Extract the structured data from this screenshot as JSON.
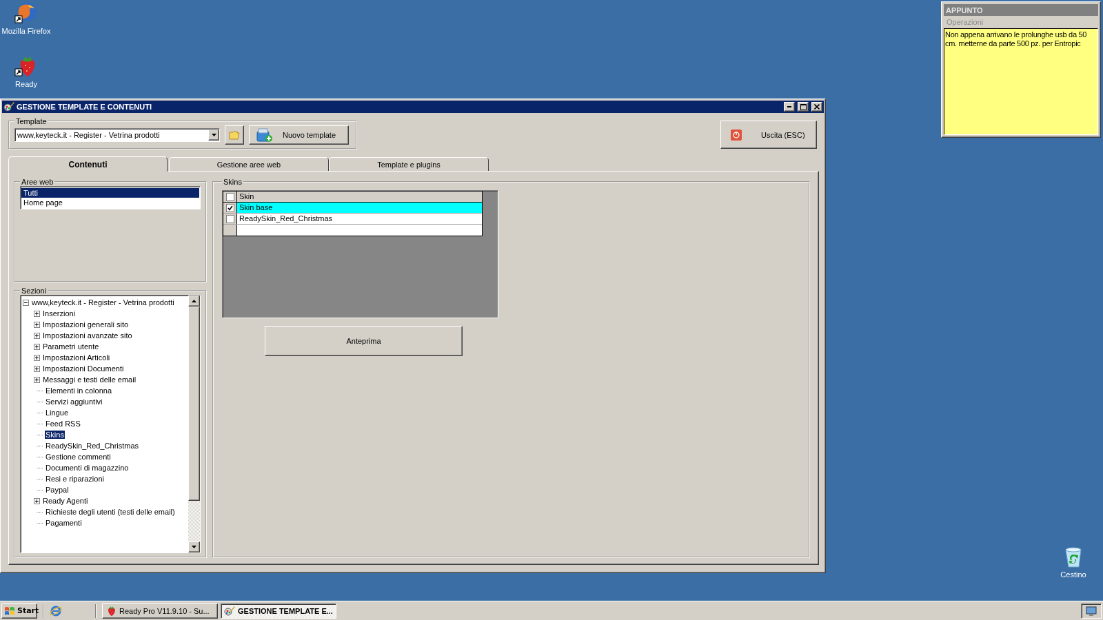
{
  "desktop_icons": [
    {
      "label": "Mozilla Firefox",
      "kind": "firefox"
    },
    {
      "label": "Ready",
      "kind": "strawberry"
    }
  ],
  "window": {
    "title": "GESTIONE TEMPLATE E CONTENUTI",
    "template": {
      "label": "Template",
      "value": "www,keyteck.it - Register - Vetrina prodotti"
    },
    "new_template_button": "Nuovo template",
    "exit_button": "Uscita (ESC)",
    "tabs": [
      {
        "label": "Contenuti",
        "selected": true
      },
      {
        "label": "Gestione aree web",
        "selected": false
      },
      {
        "label": "Template e plugins",
        "selected": false
      }
    ],
    "web_areas": {
      "label": "Aree web",
      "items": [
        {
          "label": "Tutti",
          "selected": true
        },
        {
          "label": "Home page",
          "selected": false
        }
      ]
    },
    "sections": {
      "label": "Sezioni",
      "tree": {
        "label": "www,keyteck.it - Register - Vetrina prodotti",
        "kind": "branch",
        "expanded": true,
        "selected": false,
        "children": [
          {
            "label": "Inserzioni",
            "kind": "branch",
            "expanded": false,
            "selected": false
          },
          {
            "label": "Impostazioni generali sito",
            "kind": "branch",
            "expanded": false,
            "selected": false
          },
          {
            "label": "Impostazioni avanzate sito",
            "kind": "branch",
            "expanded": false,
            "selected": false
          },
          {
            "label": "Parametri utente",
            "kind": "branch",
            "expanded": false,
            "selected": false
          },
          {
            "label": "Impostazioni Articoli",
            "kind": "branch",
            "expanded": false,
            "selected": false
          },
          {
            "label": "Impostazioni Documenti",
            "kind": "branch",
            "expanded": false,
            "selected": false
          },
          {
            "label": "Messaggi e testi delle email",
            "kind": "branch",
            "expanded": false,
            "selected": false
          },
          {
            "label": "Elementi in colonna",
            "kind": "leaf",
            "selected": false
          },
          {
            "label": "Servizi aggiuntivi",
            "kind": "leaf",
            "selected": false
          },
          {
            "label": "Lingue",
            "kind": "leaf",
            "selected": false
          },
          {
            "label": "Feed RSS",
            "kind": "leaf",
            "selected": false
          },
          {
            "label": "Skins",
            "kind": "leaf",
            "selected": true
          },
          {
            "label": "ReadySkin_Red_Christmas",
            "kind": "leaf",
            "selected": false
          },
          {
            "label": "Gestione commenti",
            "kind": "leaf",
            "selected": false
          },
          {
            "label": "Documenti di magazzino",
            "kind": "leaf",
            "selected": false
          },
          {
            "label": "Resi e riparazioni",
            "kind": "leaf",
            "selected": false
          },
          {
            "label": "Paypal",
            "kind": "leaf",
            "selected": false
          },
          {
            "label": "Ready Agenti",
            "kind": "branch",
            "expanded": false,
            "selected": false
          },
          {
            "label": "Richieste degli utenti (testi delle email)",
            "kind": "leaf",
            "selected": false
          },
          {
            "label": "Pagamenti",
            "kind": "leaf",
            "selected": false
          }
        ]
      }
    },
    "skins": {
      "label": "Skins",
      "header": {
        "label": "Skin",
        "checked": false
      },
      "rows": [
        {
          "label": "Skin base",
          "checked": true,
          "selected": true
        },
        {
          "label": "ReadySkin_Red_Christmas",
          "checked": false,
          "selected": false
        }
      ],
      "preview_button": "Anteprima"
    }
  },
  "note": {
    "title": "APPUNTO",
    "menu": [
      {
        "label": "Operazioni",
        "disabled": true
      }
    ],
    "text": "Non appena arrivano le prolunghe usb da 50 cm. metterne da parte 500 pz. per Entropic"
  },
  "recycle_bin": {
    "label": "Cestino"
  },
  "taskbar": {
    "start": "Start",
    "tasks": [
      {
        "label": "Ready Pro V11.9.10 - Su...",
        "kind": "strawberry",
        "selected": false
      },
      {
        "label": "GESTIONE TEMPLATE E...",
        "kind": "app",
        "selected": true
      }
    ]
  }
}
